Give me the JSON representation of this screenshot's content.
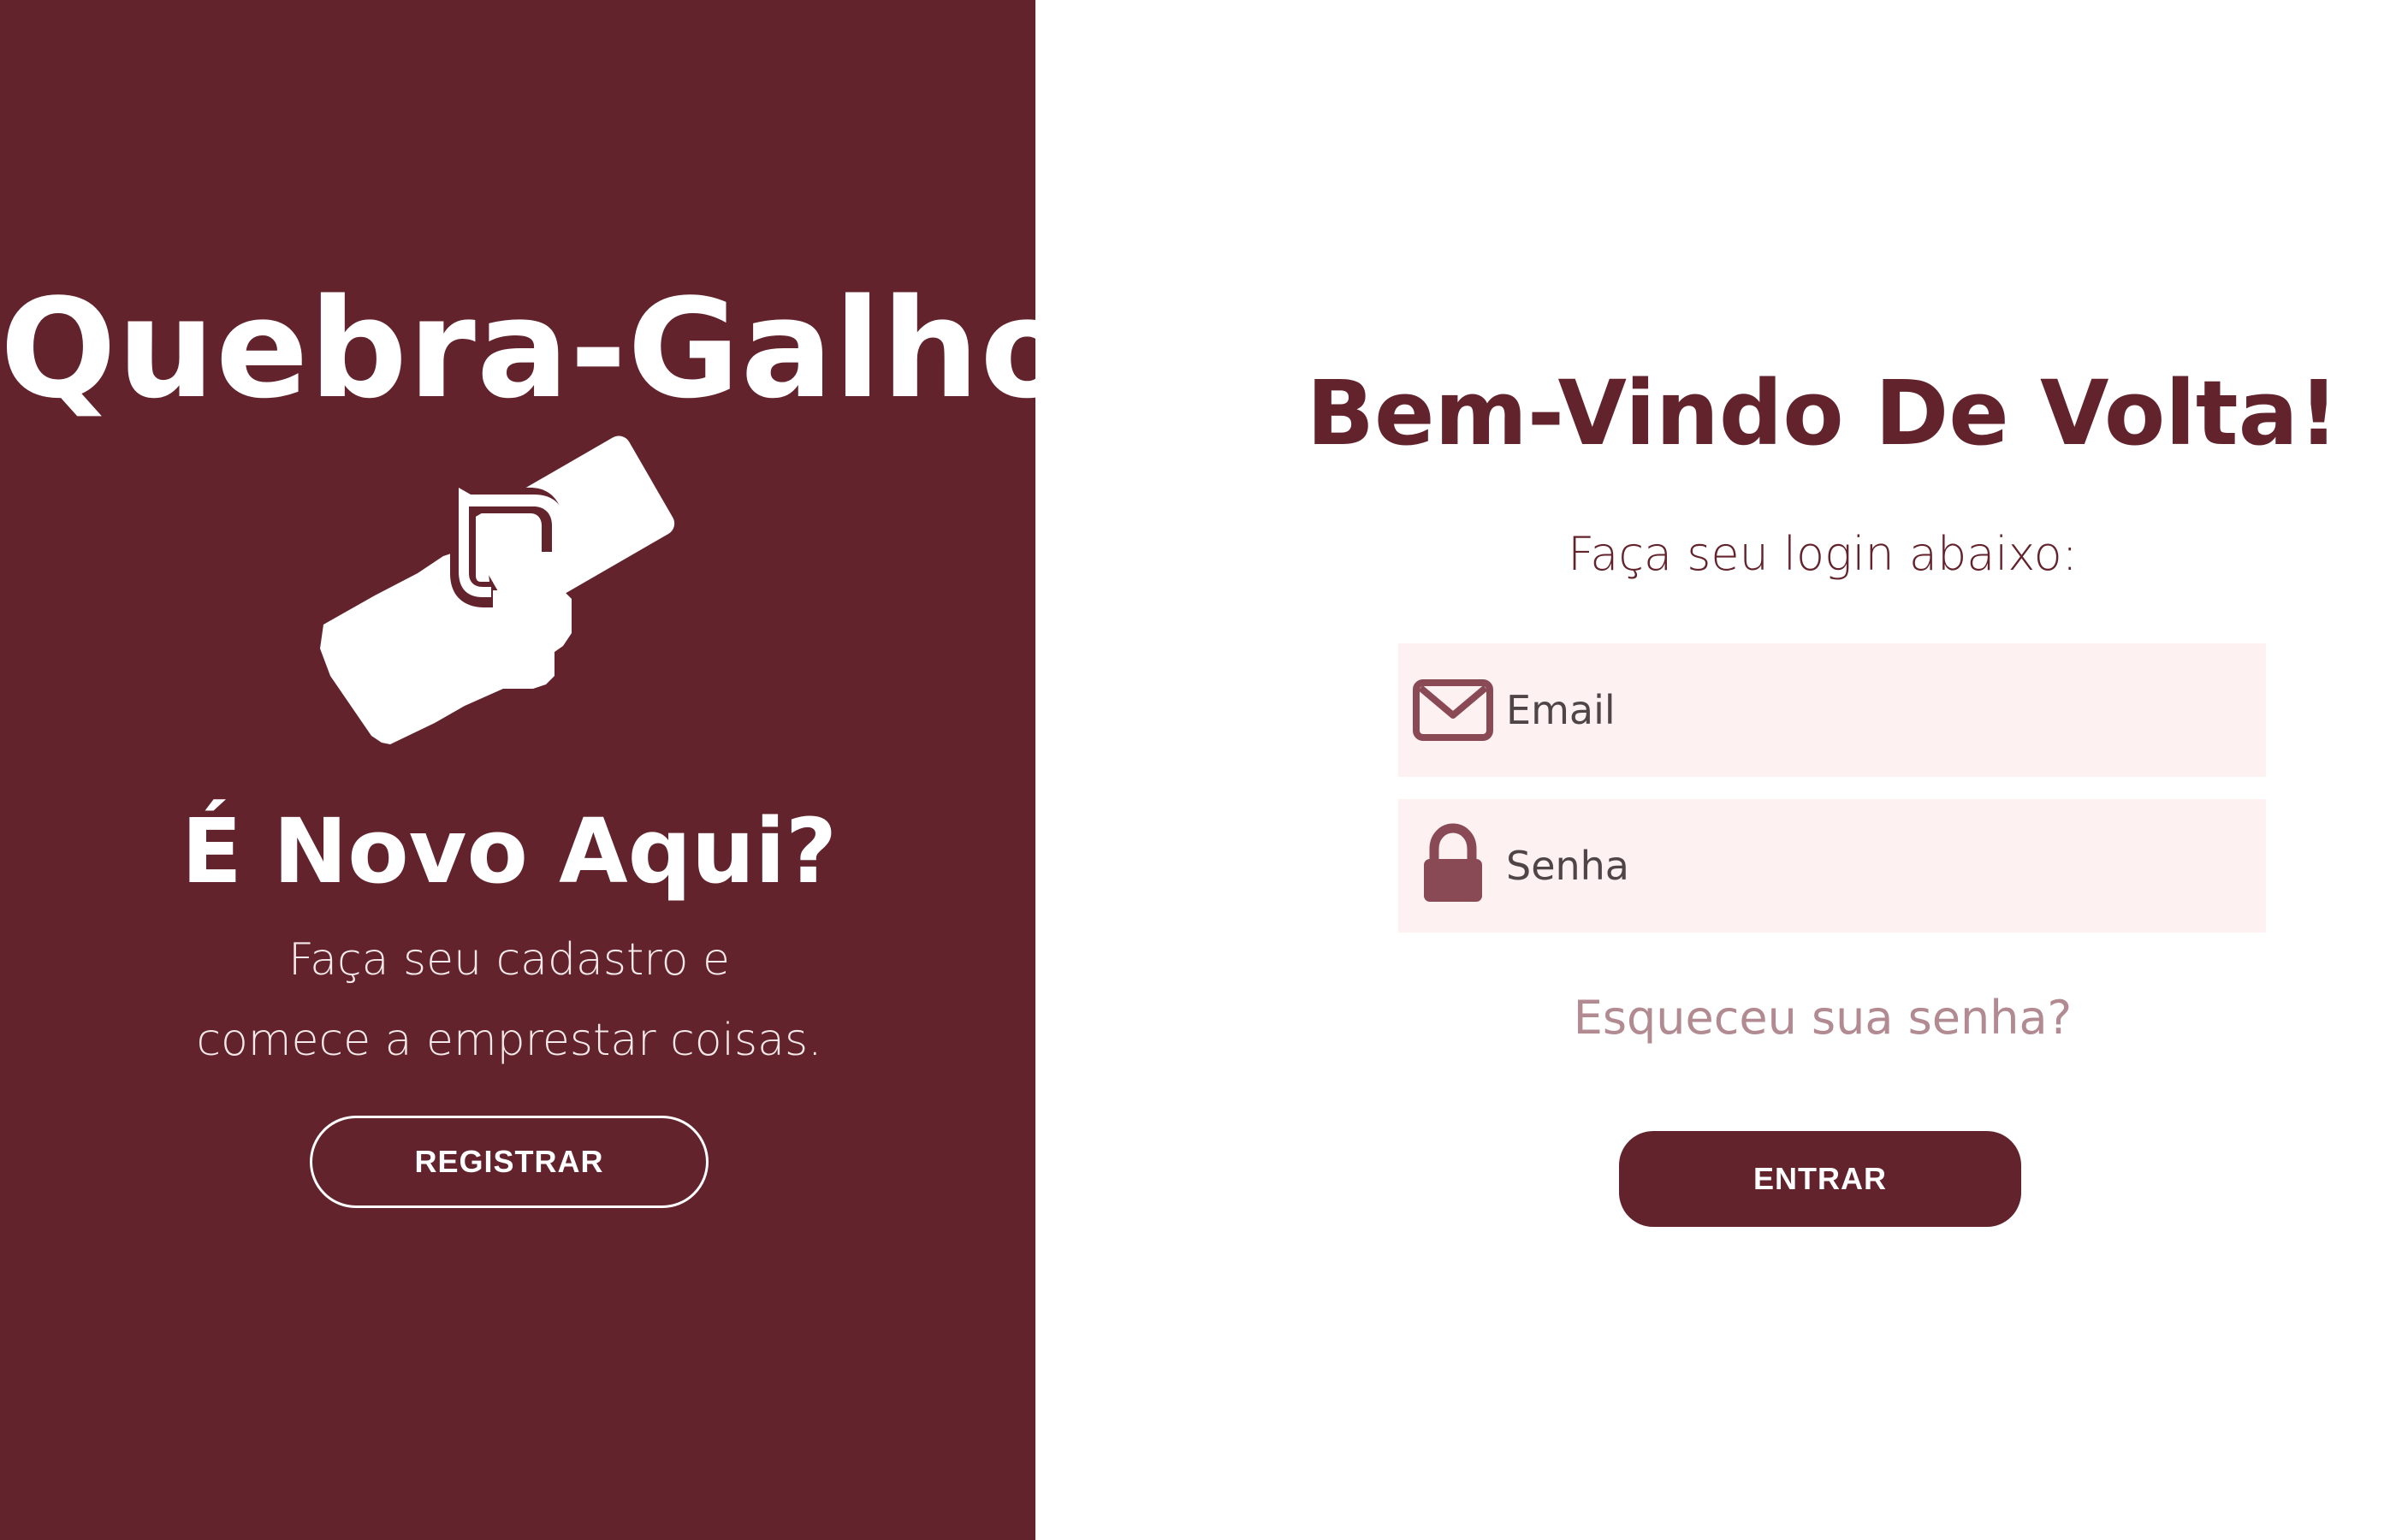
{
  "left_panel": {
    "brand_title": "Quebra-Galho",
    "brand_icon": "hands-exchange-icon",
    "heading": "É Novo Aqui?",
    "description_line1": "Faça seu cadastro e",
    "description_line2": "comece a emprestar coisas.",
    "register_button_label": "REGISTRAR"
  },
  "right_panel": {
    "title": "Bem-Vindo De Volta!",
    "subtitle": "Faça seu login abaixo:",
    "email_field": {
      "icon": "envelope-icon",
      "placeholder": "Email",
      "value": ""
    },
    "password_field": {
      "icon": "lock-icon",
      "placeholder": "Senha",
      "value": ""
    },
    "forgot_password_label": "Esqueceu sua senha?",
    "login_button_label": "ENTRAR"
  },
  "colors": {
    "brand": "#63232c",
    "input_background": "#fdf1f2",
    "link": "#b28a91",
    "icon": "#8a4a55"
  }
}
